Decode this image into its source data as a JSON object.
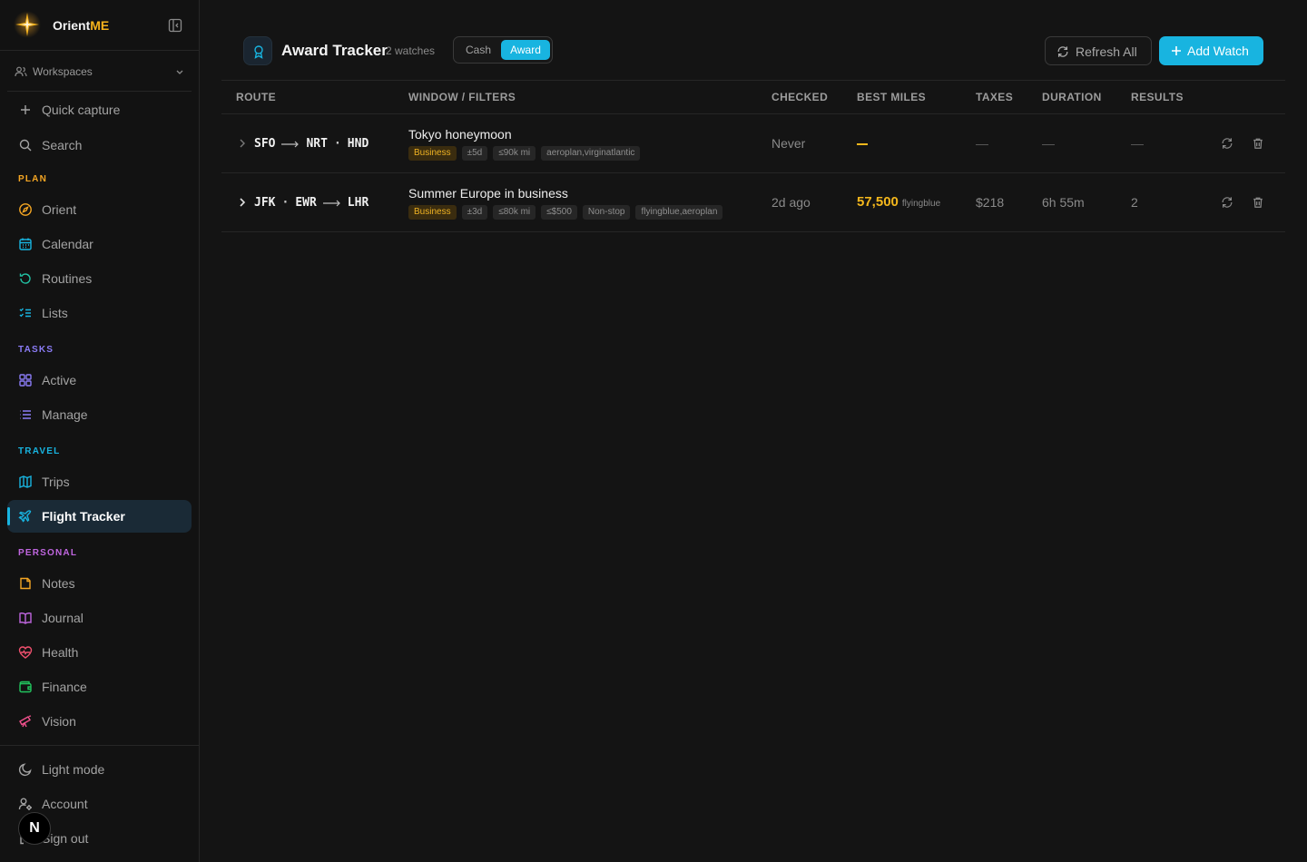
{
  "brand": {
    "name": "Orient",
    "accent": "ME"
  },
  "sidebar": {
    "workspaces_label": "Workspaces",
    "top_items": [
      {
        "label": "Quick capture",
        "icon": "plus-icon"
      },
      {
        "label": "Search",
        "icon": "search-icon"
      }
    ],
    "sections": [
      {
        "title": "PLAN",
        "color": "#f5a623"
      },
      {
        "title": "TASKS",
        "color": "#8b7cf6"
      },
      {
        "title": "TRAVEL",
        "color": "#18b4e0"
      },
      {
        "title": "PERSONAL",
        "color": "#c066e0"
      }
    ],
    "items": [
      {
        "label": "Orient",
        "icon": "compass-icon"
      },
      {
        "label": "Calendar",
        "icon": "calendar-icon"
      },
      {
        "label": "Routines",
        "icon": "refresh-icon"
      },
      {
        "label": "Lists",
        "icon": "list-check-icon"
      },
      {
        "label": "Active",
        "icon": "grid-icon"
      },
      {
        "label": "Manage",
        "icon": "list-icon"
      },
      {
        "label": "Trips",
        "icon": "map-icon"
      },
      {
        "label": "Flight Tracker",
        "icon": "plane-icon",
        "active": true
      },
      {
        "label": "Notes",
        "icon": "note-icon"
      },
      {
        "label": "Journal",
        "icon": "book-icon"
      },
      {
        "label": "Health",
        "icon": "heart-pulse-icon"
      },
      {
        "label": "Finance",
        "icon": "wallet-icon"
      },
      {
        "label": "Vision",
        "icon": "telescope-icon"
      }
    ],
    "bottom_items": [
      {
        "label": "Light mode",
        "icon": "moon-icon"
      },
      {
        "label": "Account",
        "icon": "user-gear-icon"
      },
      {
        "label": "Sign out",
        "icon": "logout-icon"
      }
    ],
    "fab_label": "N"
  },
  "header": {
    "title": "Award Tracker",
    "watch_count": "2 watches",
    "toggle": {
      "cash": "Cash",
      "award": "Award",
      "selected": "Award"
    },
    "refresh_label": "Refresh All",
    "add_label": "Add Watch"
  },
  "table": {
    "columns": [
      "ROUTE",
      "WINDOW / FILTERS",
      "CHECKED",
      "BEST MILES",
      "TAXES",
      "DURATION",
      "RESULTS"
    ],
    "rows": [
      {
        "origin": "SFO",
        "destinations": [
          "NRT",
          "HND"
        ],
        "name": "Tokyo honeymoon",
        "tags": [
          "Business",
          "±5d",
          "≤90k mi",
          "aeroplan,virginatlantic"
        ],
        "checked": "Never",
        "best_miles": "",
        "program": "",
        "taxes": "—",
        "duration": "—",
        "results": "—"
      },
      {
        "origins": [
          "JFK",
          "EWR"
        ],
        "destination": "LHR",
        "name": "Summer Europe in business",
        "tags": [
          "Business",
          "±3d",
          "≤80k mi",
          "≤$500",
          "Non-stop",
          "flyingblue,aeroplan"
        ],
        "checked": "2d ago",
        "best_miles": "57,500",
        "program": "flyingblue",
        "taxes": "$218",
        "duration": "6h 55m",
        "results": "2"
      }
    ]
  },
  "colors": {
    "accent": "#18b4e0",
    "miles": "#f4b71c",
    "brand_accent": "#f5b21c"
  }
}
